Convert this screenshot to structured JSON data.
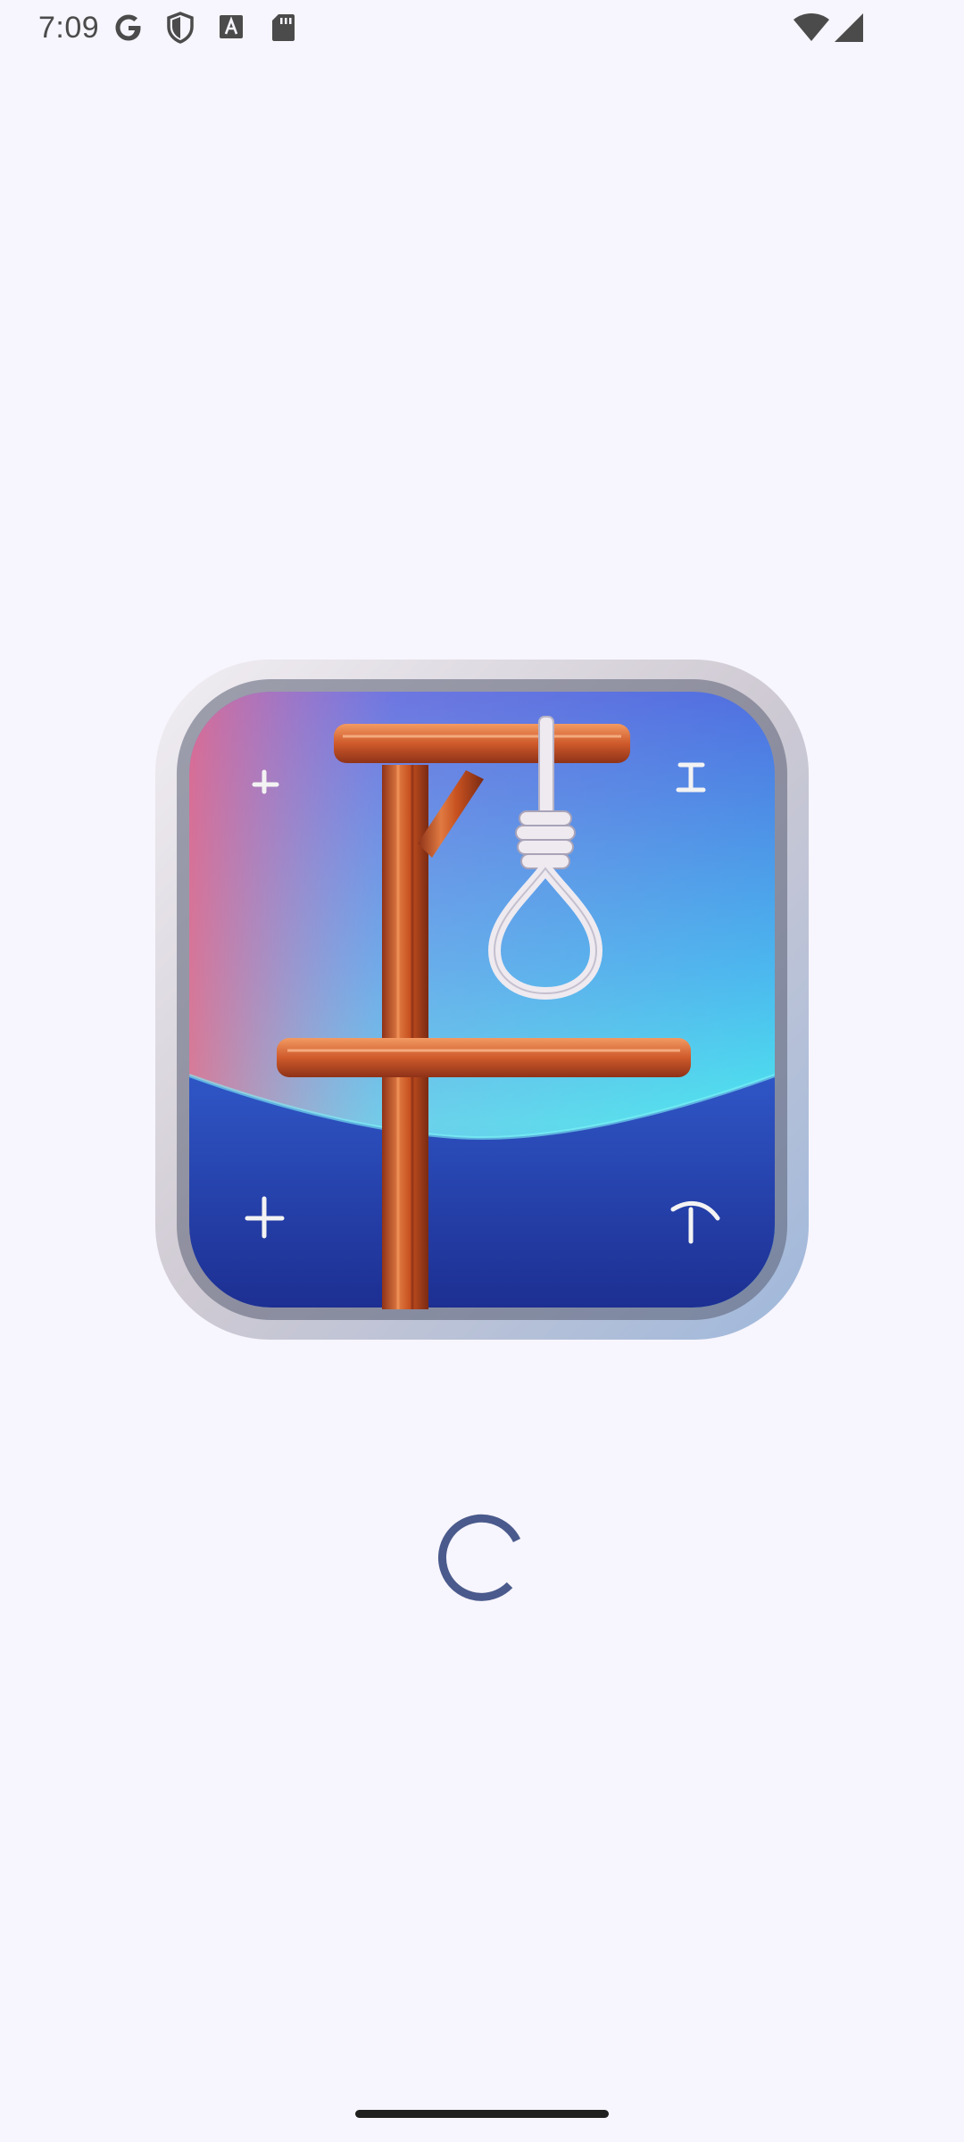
{
  "status_bar": {
    "time": "7:09",
    "left_icons": [
      "google-icon",
      "shield-icon",
      "font-a-icon",
      "sd-card-icon"
    ],
    "right_icons": [
      "wifi-icon",
      "cellular-signal-icon"
    ]
  },
  "splash": {
    "app_icon": "hangman-gallows-app-icon",
    "loading_indicator": "circular-progress-spinner"
  },
  "colors": {
    "background": "#f7f5fd",
    "spinner": "#4a5a8c",
    "icon_frame": "#d9d5dc",
    "icon_gradient_top": "#4f7ce8",
    "icon_gradient_mid": "#45e0ec",
    "icon_gradient_bottom": "#2a45b8",
    "wood": "#c8552a"
  }
}
